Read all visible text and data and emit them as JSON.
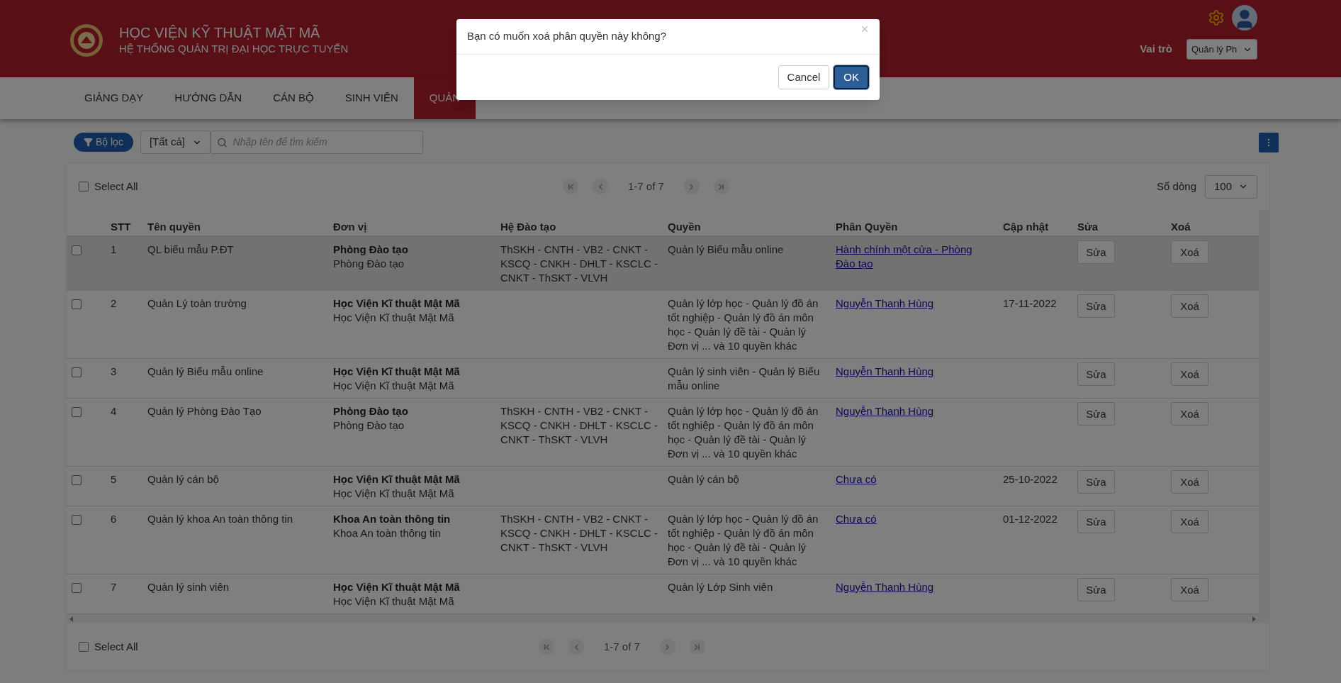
{
  "header": {
    "title": "HỌC VIỆN KỸ THUẬT MẬT MÃ",
    "subtitle": "HỆ THỐNG QUẢN TRỊ ĐẠI HỌC TRỰC TUYẾN",
    "role_label": "Vai trò",
    "role_select": "Quản lý Ph"
  },
  "nav": [
    {
      "label": "GIẢNG DẠY",
      "selected": false
    },
    {
      "label": "HƯỚNG DẪN",
      "selected": false
    },
    {
      "label": "CÁN BỘ",
      "selected": false
    },
    {
      "label": "SINH VIÊN",
      "selected": false
    },
    {
      "label": "QUẢN",
      "selected": true
    }
  ],
  "toolbar": {
    "filter_button": "Bộ lọc",
    "category_select": "[Tất cả]",
    "search_placeholder": "Nhập tên để tìm kiếm"
  },
  "top_bar": {
    "select_all": {
      "label": "Select All",
      "checked": false
    },
    "range": "1-7 of 7",
    "rows_label": "Số dòng",
    "rows_select": "100"
  },
  "table": {
    "columns": [
      "STT",
      "Tên quyền",
      "Đơn vị",
      "Hệ Đào tạo",
      "Quyền",
      "Phân Quyền",
      "Cập nhật",
      "Sửa",
      "Xoá"
    ],
    "rows": [
      {
        "checked": false,
        "highlighted": true,
        "stt": "1",
        "name": "QL biểu mẫu P.ĐT",
        "unit_main": "Phòng Đào tạo",
        "unit": "Phòng Đào tạo",
        "training": "ThSKH - CNTH - VB2 - CNKT - KSCQ - CNKH - DHLT - KSCLC - CNKT - ThSKT - VLVH",
        "rights": "Quản lý Biểu mẫu online",
        "assignee": "Hành chính một cửa - Phòng Đào tạo",
        "updated": "",
        "edit": "Sửa",
        "delete": "Xoá"
      },
      {
        "checked": false,
        "highlighted": false,
        "stt": "2",
        "name": "Quản Lý toàn trường",
        "unit_main": "Học Viện Kĩ thuật Mật Mã",
        "unit": "Học Viện Kĩ thuật Mật Mã",
        "training": "",
        "rights": "Quản lý lớp học - Quản lý đồ án tốt nghiệp - Quản lý đồ án môn học - Quản lý đề tài - Quản lý Đơn vị ... và 10 quyền khác",
        "assignee": "Nguyễn Thanh Hùng",
        "updated": "17-11-2022",
        "edit": "Sửa",
        "delete": "Xoá"
      },
      {
        "checked": false,
        "highlighted": false,
        "stt": "3",
        "name": "Quản lý Biểu mẫu online",
        "unit_main": "Học Viện Kĩ thuật Mật Mã",
        "unit": "Học Viện Kĩ thuật Mật Mã",
        "training": "",
        "rights": "Quản lý sinh viên - Quản lý Biểu mẫu online",
        "assignee": "Nguyễn Thanh Hùng",
        "updated": "",
        "edit": "Sửa",
        "delete": "Xoá"
      },
      {
        "checked": false,
        "highlighted": false,
        "stt": "4",
        "name": "Quản lý Phòng Đào Tạo",
        "unit_main": "Phòng Đào tạo",
        "unit": "Phòng Đào tạo",
        "training": "ThSKH - CNTH - VB2 - CNKT - KSCQ - CNKH - DHLT - KSCLC - CNKT - ThSKT - VLVH",
        "rights": "Quản lý lớp học - Quản lý đồ án tốt nghiệp - Quản lý đồ án môn học - Quản lý đề tài - Quản lý Đơn vị ... và 10 quyền khác",
        "assignee": "Nguyễn Thanh Hùng",
        "updated": "",
        "edit": "Sửa",
        "delete": "Xoá"
      },
      {
        "checked": false,
        "highlighted": false,
        "stt": "5",
        "name": "Quản lý cán bộ",
        "unit_main": "Học Viện Kĩ thuật Mật Mã",
        "unit": "Học Viện Kĩ thuật Mật Mã",
        "training": "",
        "rights": "Quản lý cán bộ",
        "assignee": "Chưa có",
        "updated": "25-10-2022",
        "edit": "Sửa",
        "delete": "Xoá"
      },
      {
        "checked": false,
        "highlighted": false,
        "stt": "6",
        "name": "Quản lý khoa An toàn thông tin",
        "unit_main": "Khoa An toàn thông tin",
        "unit": "Khoa An toàn thông tin",
        "training": "ThSKH - CNTH - VB2 - CNKT - KSCQ - CNKH - DHLT - KSCLC - CNKT - ThSKT - VLVH",
        "rights": "Quản lý lớp học - Quản lý đồ án tốt nghiệp - Quản lý đồ án môn học - Quản lý đề tài - Quản lý Đơn vị ... và 10 quyền khác",
        "assignee": "Chưa có",
        "updated": "01-12-2022",
        "edit": "Sửa",
        "delete": "Xoá"
      },
      {
        "checked": false,
        "highlighted": false,
        "stt": "7",
        "name": "Quản lý sinh viên",
        "unit_main": "Học Viện Kĩ thuật Mật Mã",
        "unit": "Học Viện Kĩ thuật Mật Mã",
        "training": "",
        "rights": "Quản lý Lớp Sinh viên",
        "assignee": "Nguyễn Thanh Hùng",
        "updated": "",
        "edit": "Sửa",
        "delete": "Xoá"
      }
    ]
  },
  "bottom_bar": {
    "select_all": {
      "label": "Select All",
      "checked": false
    },
    "range": "1-7 of 7"
  },
  "dialog": {
    "message": "Bạn có muốn xoá phân quyền này không?",
    "buttons": [
      {
        "label": "Cancel",
        "kind": "secondary"
      },
      {
        "label": "OK",
        "kind": "primary"
      }
    ]
  }
}
